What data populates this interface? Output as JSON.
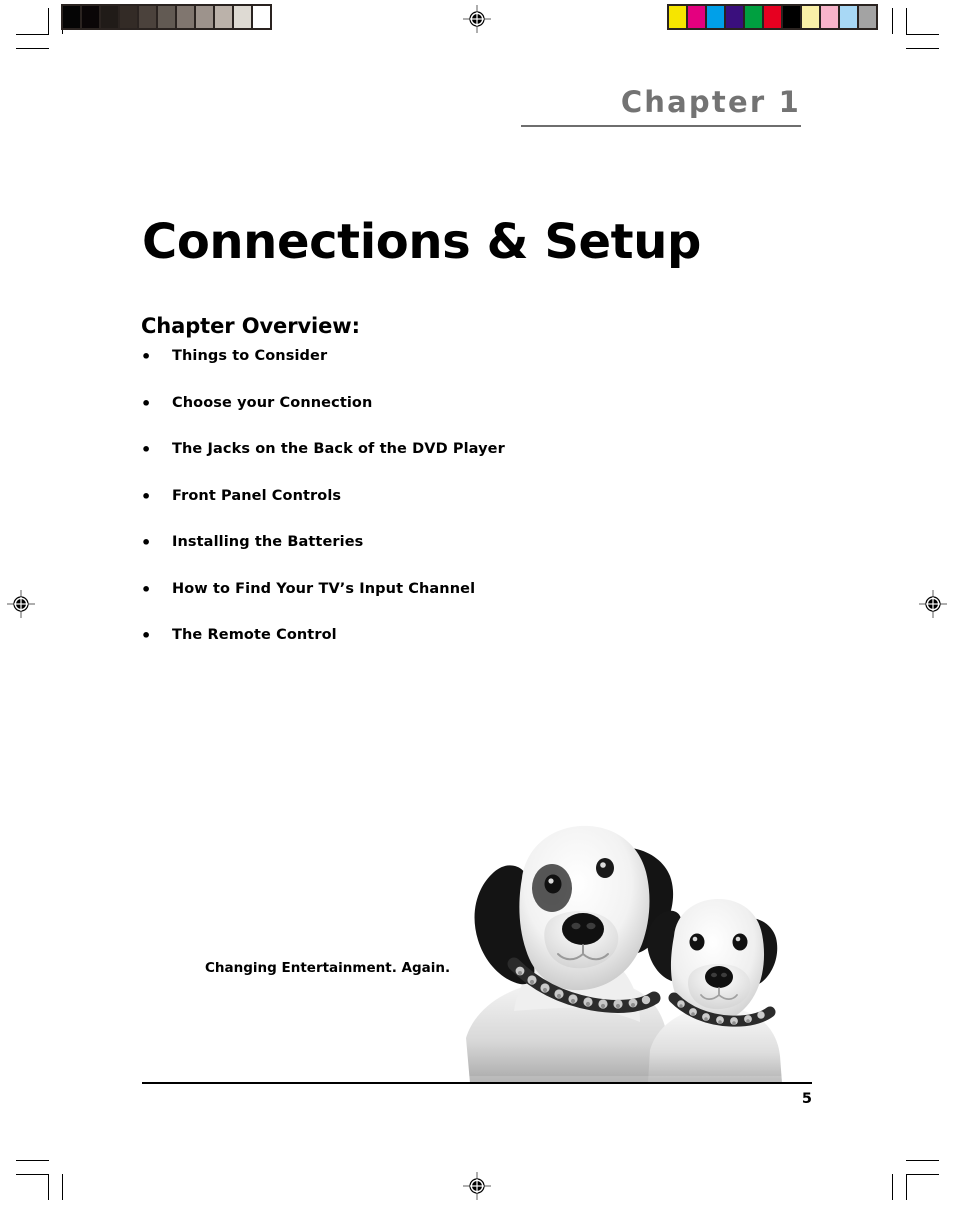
{
  "document": {
    "chapter_label": "Chapter 1",
    "title": "Connections & Setup",
    "page_number": "5",
    "tagline": "Changing Entertainment. Again."
  },
  "overview": {
    "heading": "Chapter Overview:",
    "bullet_glyph": "•",
    "items": [
      {
        "label": "Things to Consider"
      },
      {
        "label": "Choose your Connection"
      },
      {
        "label": "The Jacks on the Back of the DVD Player"
      },
      {
        "label": "Front Panel Controls"
      },
      {
        "label": "Installing the Batteries"
      },
      {
        "label": "How to Find Your TV’s Input Channel"
      },
      {
        "label": "The Remote Control"
      }
    ]
  },
  "print_marks": {
    "grayscale_bar": {
      "name": "grayscale-calibration-bar",
      "patches": [
        "#050505",
        "#0a0607",
        "#201b18",
        "#332b26",
        "#4b423c",
        "#625a53",
        "#80766f",
        "#9d938c",
        "#bbb2aa",
        "#dedad3",
        "#ffffff"
      ]
    },
    "color_bar": {
      "name": "color-calibration-bar",
      "patches": [
        "#f6e500",
        "#e4007f",
        "#00a0e9",
        "#3a0f7d",
        "#00a040",
        "#e60020",
        "#000000",
        "#faf0a8",
        "#f8b4ca",
        "#a8d8f5",
        "#a3a3a3"
      ]
    },
    "registration_mark_name": "registration-target-mark",
    "crop_mark_name": "crop-mark"
  },
  "photo": {
    "name": "dogs-photo",
    "description": "Two dogs wearing studded collars, black and white photograph"
  }
}
